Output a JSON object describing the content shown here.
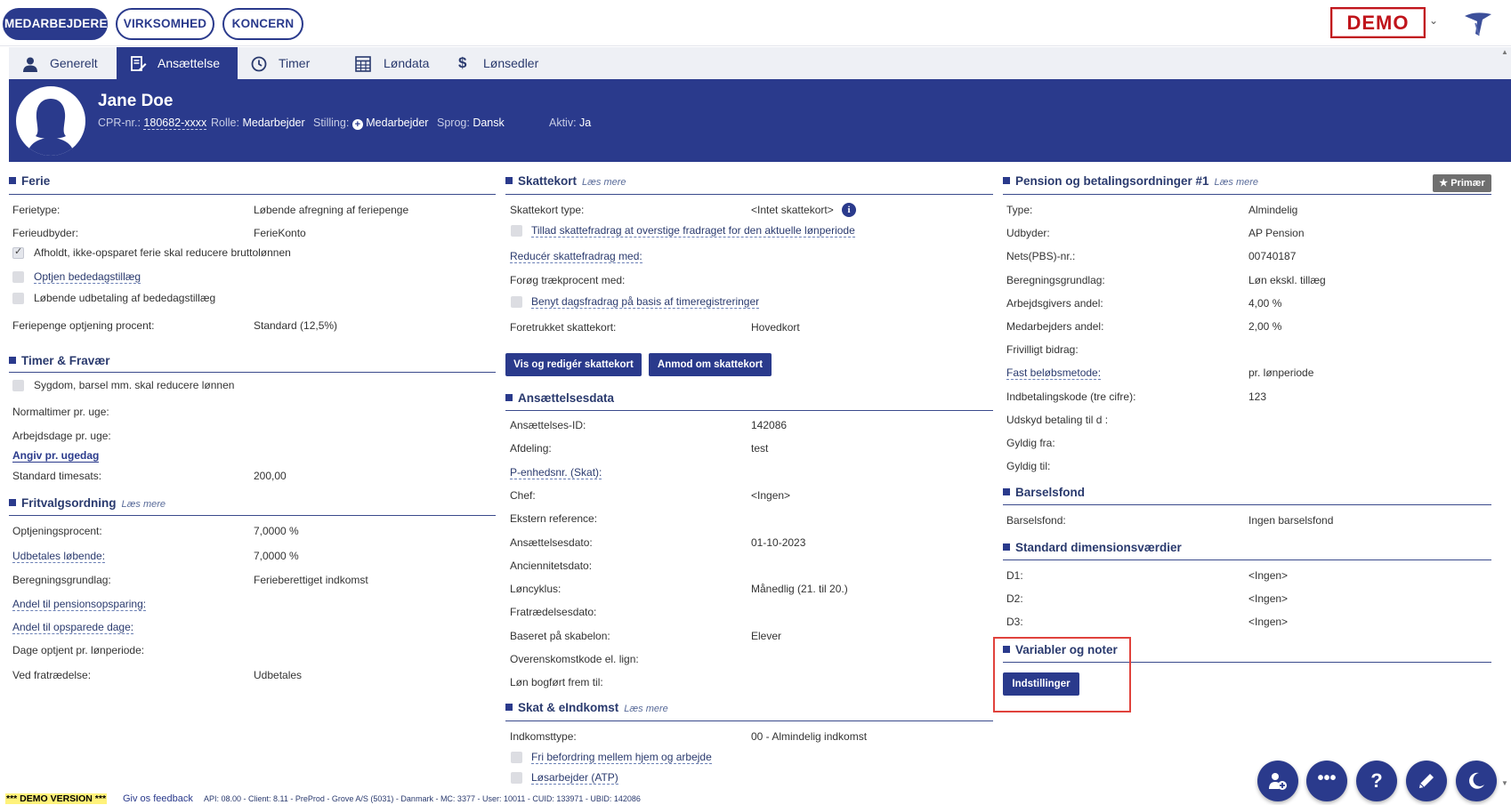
{
  "topbar": {
    "nav": [
      "MEDARBEJDERE",
      "VIRKSOMHED",
      "KONCERN"
    ],
    "demo": "DEMO"
  },
  "tabs": [
    "Generelt",
    "Ansættelse",
    "Timer",
    "Løndata",
    "Lønsedler"
  ],
  "employee": {
    "name": "Jane Doe",
    "cpr_label": "CPR-nr.:",
    "cpr_value": "180682-xxxx",
    "rolle_label": "Rolle:",
    "rolle_value": "Medarbejder",
    "stilling_label": "Stilling:",
    "stilling_value": "Medarbejder",
    "sprog_label": "Sprog:",
    "sprog_value": "Dansk",
    "aktiv_label": "Aktiv:",
    "aktiv_value": "Ja"
  },
  "ferie": {
    "title": "Ferie",
    "ferietype_label": "Ferietype:",
    "ferietype_value": "Løbende afregning af feriepenge",
    "udbyder_label": "Ferieudbyder:",
    "udbyder_value": "FerieKonto",
    "cb1": "Afholdt, ikke-opsparet ferie skal reducere bruttolønnen",
    "cb2": "Optjen bededagstillæg",
    "cb3": "Løbende udbetaling af bededagstillæg",
    "procent_label": "Feriepenge optjening procent:",
    "procent_value": "Standard (12,5%)"
  },
  "timer": {
    "title": "Timer & Fravær",
    "cb1": "Sygdom, barsel mm. skal reducere lønnen",
    "normal_label": "Normaltimer pr. uge:",
    "arbejdsdage_label": "Arbejdsdage pr. uge:",
    "angiv_link": "Angiv pr. ugedag",
    "timesats_label": "Standard timesats:",
    "timesats_value": "200,00"
  },
  "fritvalg": {
    "title": "Fritvalgsordning",
    "laes": "Læs mere",
    "optj_label": "Optjeningsprocent:",
    "optj_value": "7,0000 %",
    "udbet_label": "Udbetales løbende:",
    "udbet_value": "7,0000 %",
    "beregn_label": "Beregningsgrundlag:",
    "beregn_value": "Ferieberettiget indkomst",
    "pension_label": "Andel til pensionsopsparing:",
    "opsparede_label": "Andel til opsparede dage:",
    "dage_label": "Dage optjent pr. lønperiode:",
    "fratr_label": "Ved fratrædelse:",
    "fratr_value": "Udbetales"
  },
  "skattekort": {
    "title": "Skattekort",
    "laes": "Læs mere",
    "type_label": "Skattekort type:",
    "type_value": "<Intet skattekort>",
    "cb1": "Tillad skattefradrag at overstige fradraget for den aktuelle lønperiode",
    "reducer_label": "Reducér skattefradrag med:",
    "foreg_label": "Forøg trækprocent med:",
    "cb2": "Benyt dagsfradrag på basis af timeregistreringer",
    "foretrukket_label": "Foretrukket skattekort:",
    "foretrukket_value": "Hovedkort",
    "btn1": "Vis og redigér skattekort",
    "btn2": "Anmod om skattekort"
  },
  "ansaettelse": {
    "title": "Ansættelsesdata",
    "rows": [
      {
        "label": "Ansættelses-ID:",
        "value": "142086"
      },
      {
        "label": "Afdeling:",
        "value": "test"
      },
      {
        "label": "P-enhedsnr. (Skat):",
        "value": ""
      },
      {
        "label": "Chef:",
        "value": "<Ingen>"
      },
      {
        "label": "Ekstern reference:",
        "value": ""
      },
      {
        "label": "Ansættelsesdato:",
        "value": "01-10-2023"
      },
      {
        "label": "Anciennitetsdato:",
        "value": ""
      },
      {
        "label": "Løncyklus:",
        "value": "Månedlig (21. til 20.)"
      },
      {
        "label": "Fratrædelsesdato:",
        "value": ""
      },
      {
        "label": "Baseret på skabelon:",
        "value": "Elever"
      },
      {
        "label": "Overenskomstkode el. lign:",
        "value": ""
      },
      {
        "label": "Løn bogført frem til:",
        "value": ""
      }
    ]
  },
  "skat_eindkomst": {
    "title": "Skat & eIndkomst",
    "laes": "Læs mere",
    "indkomst_label": "Indkomsttype:",
    "indkomst_value": "00 - Almindelig indkomst",
    "cb1": "Fri befordring mellem hjem og arbejde",
    "cb2": "Løsarbejder (ATP)"
  },
  "pension": {
    "title": "Pension og betalingsordninger #1",
    "laes": "Læs mere",
    "primaer": "Primær",
    "rows": [
      {
        "label": "Type:",
        "value": "Almindelig"
      },
      {
        "label": "Udbyder:",
        "value": "AP Pension"
      },
      {
        "label": "Nets(PBS)-nr.:",
        "value": "00740187"
      },
      {
        "label": "Beregningsgrundlag:",
        "value": "Løn ekskl. tillæg"
      },
      {
        "label": "Arbejdsgivers andel:",
        "value": "4,00 %"
      },
      {
        "label": "Medarbejders andel:",
        "value": "2,00 %"
      },
      {
        "label": "Frivilligt bidrag:",
        "value": ""
      },
      {
        "label": "Fast beløbsmetode:",
        "value": "pr. lønperiode"
      },
      {
        "label": "Indbetalingskode (tre cifre):",
        "value": "123"
      },
      {
        "label": "Udskyd betaling til d :",
        "value": ""
      },
      {
        "label": "Gyldig fra:",
        "value": ""
      },
      {
        "label": "Gyldig til:",
        "value": ""
      }
    ]
  },
  "barselsfond": {
    "title": "Barselsfond",
    "label": "Barselsfond:",
    "value": "Ingen barselsfond"
  },
  "dimension": {
    "title": "Standard dimensionsværdier",
    "rows": [
      {
        "label": "D1:",
        "value": "<Ingen>"
      },
      {
        "label": "D2:",
        "value": "<Ingen>"
      },
      {
        "label": "D3:",
        "value": "<Ingen>"
      }
    ]
  },
  "variabler": {
    "title": "Variabler og noter",
    "btn": "Indstillinger"
  },
  "footer": {
    "demo_version": "*** DEMO VERSION ***",
    "feedback": "Giv os feedback",
    "info": "API: 08.00 - Client: 8.11 - PreProd - Grove A/S (5031) - Danmark - MC: 3377 - User: 10011 - CUID: 133971 - UBID: 142086"
  },
  "colors": {
    "primary": "#2a3a8c",
    "demo_red": "#c0141b",
    "highlight": "#e0423c"
  },
  "icons": [
    "user-icon",
    "edit-icon",
    "clock-icon",
    "table-icon",
    "dollar-icon",
    "add-user-icon",
    "more-icon",
    "help-icon",
    "pencil-icon",
    "moon-icon"
  ]
}
